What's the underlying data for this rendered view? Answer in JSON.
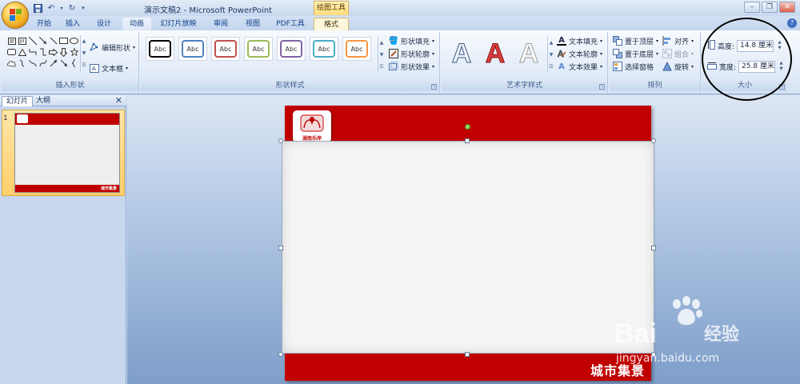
{
  "window": {
    "title": "演示文稿2 - Microsoft PowerPoint",
    "contextual_label": "绘图工具",
    "min_glyph": "–",
    "restore_glyph": "❐",
    "close_glyph": "✕"
  },
  "tabs": [
    "开始",
    "插入",
    "设计",
    "动画",
    "幻灯片放映",
    "审阅",
    "视图",
    "PDF工具",
    "格式"
  ],
  "active_tab": "格式",
  "ribbon": {
    "insert_shapes": {
      "label": "插入形状",
      "edit_shape": "编辑形状",
      "text_box": "文本框"
    },
    "shape_styles": {
      "label": "形状样式",
      "preview_text": "Abc",
      "preset_colors": [
        "#000000",
        "#4f81bd",
        "#c0504d",
        "#9bbb59",
        "#8064a2",
        "#4bacc6",
        "#f79646"
      ],
      "fill": "形状填充",
      "outline": "形状轮廓",
      "effects": "形状效果"
    },
    "wordart_styles": {
      "label": "艺术字样式",
      "letter": "A",
      "text_fill": "文本填充",
      "text_outline": "文本轮廓",
      "text_effects": "文本效果"
    },
    "arrange": {
      "label": "排列",
      "bring_front": "置于顶层",
      "send_back": "置于底层",
      "selection_pane": "选择窗格",
      "align": "对齐",
      "group": "组合",
      "rotate": "旋转"
    },
    "size": {
      "label": "大小",
      "height_label": "高度:",
      "height_value": "14.8 厘米",
      "width_label": "宽度:",
      "width_value": "25.8 厘米"
    }
  },
  "left_pane": {
    "tab_slides": "幻灯片",
    "tab_outline": "大纲",
    "close": "✕",
    "slide_number": "1",
    "thumb_caption": "城市集景"
  },
  "slide": {
    "logo_text": "湖南乐岸",
    "caption": "城市集景"
  },
  "watermark": {
    "brand": "Bai",
    "brand_cn": "经验",
    "url": "jingyan.baidu.com"
  },
  "colors": {
    "slide_red": "#c00000",
    "ribbon_bg": "#dfe9f5",
    "accent": "#15428b"
  }
}
